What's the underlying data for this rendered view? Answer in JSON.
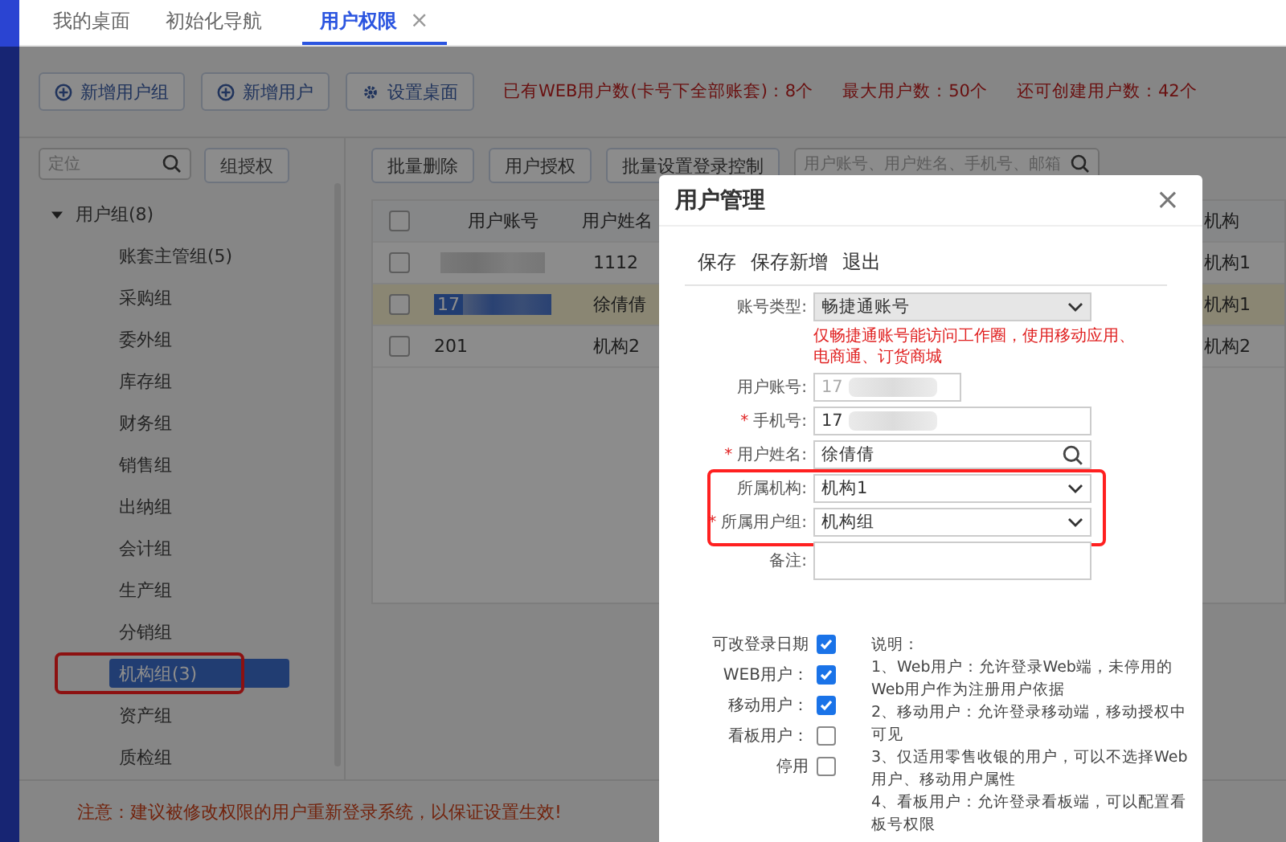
{
  "tabs": [
    {
      "label": "我的桌面",
      "selected": false
    },
    {
      "label": "初始化导航",
      "selected": false
    },
    {
      "label": "用户权限",
      "selected": true,
      "close_glyph": "×"
    }
  ],
  "toolbar": {
    "buttons": [
      "新增用户组",
      "新增用户",
      "设置桌面"
    ],
    "stats": [
      "已有WEB用户数(卡号下全部账套)：8个",
      "最大用户数：50个",
      "还可创建用户数：42个"
    ]
  },
  "sidebar": {
    "search_placeholder": "定位",
    "button": "组授权",
    "tree": [
      {
        "label": "用户组(8)",
        "expanded": true,
        "selected": false,
        "children": [
          {
            "label": "账套主管组(5)",
            "selected": false
          },
          {
            "label": "采购组",
            "selected": false
          },
          {
            "label": "委外组",
            "selected": false
          },
          {
            "label": "库存组",
            "selected": false
          },
          {
            "label": "财务组",
            "selected": false
          },
          {
            "label": "销售组",
            "selected": false
          },
          {
            "label": "出纳组",
            "selected": false
          },
          {
            "label": "会计组",
            "selected": false
          },
          {
            "label": "生产组",
            "selected": false
          },
          {
            "label": "分销组",
            "selected": false
          },
          {
            "label": "机构组(3)",
            "selected": true,
            "highlighted": true
          },
          {
            "label": "资产组",
            "selected": false
          },
          {
            "label": "质检组",
            "selected": false
          }
        ]
      }
    ]
  },
  "actions": {
    "buttons": [
      "批量删除",
      "用户授权",
      "批量设置登录控制"
    ],
    "search_placeholder": "用户账号、用户姓名、手机号、邮箱"
  },
  "table": {
    "select_all_checked": false,
    "columns": [
      "用户账号",
      "用户姓名",
      "机构"
    ],
    "rows": [
      {
        "checked": false,
        "selected": false,
        "account_blurred": true,
        "name": "1112",
        "org": "机构1"
      },
      {
        "checked": false,
        "selected": true,
        "account": "17",
        "account_blurred": true,
        "name": "徐倩倩",
        "org": "机构1"
      },
      {
        "checked": false,
        "selected": false,
        "account": "201",
        "account_blurred": false,
        "name": "机构2",
        "org": "机构2"
      }
    ]
  },
  "notice": "注意：建议被修改权限的用户重新登录系统，以保证设置生效!",
  "dialog": {
    "title": "用户管理",
    "close_glyph": "×",
    "commands": [
      "保存",
      "保存新增",
      "退出"
    ],
    "fields": [
      {
        "label": "账号类型:",
        "kind": "locked-select",
        "value": "畅捷通账号",
        "note": "仅畅捷通账号能访问工作圈，使用移动应用、电商通、订货商城"
      },
      {
        "label": "用户账号:",
        "kind": "locked-text",
        "value": "17",
        "blurred": true
      },
      {
        "label": "手机号:",
        "kind": "text",
        "value": "17",
        "marker": "*",
        "blurred": true
      },
      {
        "label": "用户姓名:",
        "kind": "lookup",
        "value": "徐倩倩",
        "marker": "*"
      },
      {
        "label": "所属机构:",
        "kind": "select",
        "value": "机构1",
        "highlighted": true
      },
      {
        "label": "所属用户组:",
        "kind": "select",
        "value": "机构组",
        "marker": "*",
        "highlighted": true
      },
      {
        "label": "备注:",
        "kind": "textarea"
      }
    ],
    "options": [
      {
        "label": "可改登录日期",
        "checked": true
      },
      {
        "label": "WEB用户：",
        "checked": true
      },
      {
        "label": "移动用户：",
        "checked": true
      },
      {
        "label": "看板用户：",
        "checked": false
      },
      {
        "label": "停用",
        "checked": false
      }
    ],
    "help": [
      "说明：",
      "1、Web用户：允许登录Web端，未停用的Web用户作为注册用户依据",
      "2、移动用户：允许登录移动端，移动授权中可见",
      "3、仅适用零售收银的用户，可以不选择Web用户、移动用户属性",
      "4、看板用户：允许登录看板端，可以配置看板号权限"
    ]
  }
}
